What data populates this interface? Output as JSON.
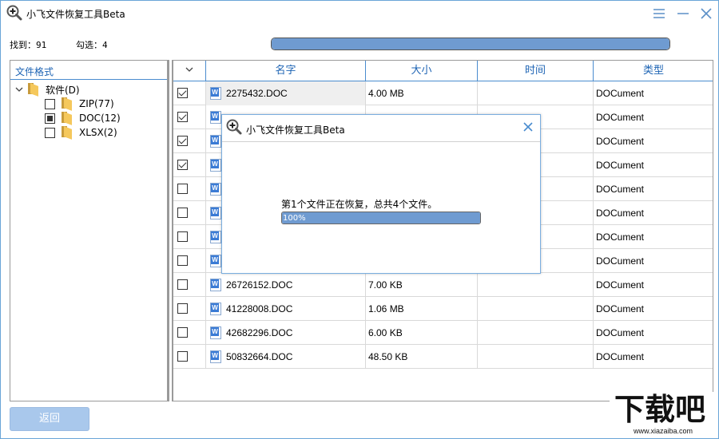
{
  "window": {
    "title": "小飞文件恢复工具Beta",
    "menu_icon": "hamburger-icon",
    "minimize_icon": "minimize-icon",
    "close_icon": "close-icon"
  },
  "stats": {
    "found_label": "找到：91",
    "checked_label": "勾选：4"
  },
  "scan_progress": {
    "fraction": 1.0
  },
  "tree": {
    "header": "文件格式",
    "root": {
      "label": "软件(D)",
      "expanded": true
    },
    "children": [
      {
        "label": "ZIP(77)",
        "state": "unchecked"
      },
      {
        "label": "DOC(12)",
        "state": "partial"
      },
      {
        "label": "XLSX(2)",
        "state": "unchecked"
      }
    ]
  },
  "table": {
    "columns": [
      "名字",
      "大小",
      "时间",
      "类型"
    ],
    "rows": [
      {
        "checked": true,
        "name": "2275432.DOC",
        "size": "4.00 MB",
        "time": "",
        "type": "DOCument"
      },
      {
        "checked": true,
        "name": "",
        "size": "",
        "time": "",
        "type": "DOCument"
      },
      {
        "checked": true,
        "name": "",
        "size": "",
        "time": "",
        "type": "DOCument"
      },
      {
        "checked": true,
        "name": "",
        "size": "",
        "time": "",
        "type": "DOCument"
      },
      {
        "checked": false,
        "name": "",
        "size": "",
        "time": "",
        "type": "DOCument"
      },
      {
        "checked": false,
        "name": "",
        "size": "",
        "time": "",
        "type": "DOCument"
      },
      {
        "checked": false,
        "name": "",
        "size": "",
        "time": "",
        "type": "DOCument"
      },
      {
        "checked": false,
        "name": "",
        "size": "",
        "time": "",
        "type": "DOCument"
      },
      {
        "checked": false,
        "name": "26726152.DOC",
        "size": "7.00 KB",
        "time": "",
        "type": "DOCument"
      },
      {
        "checked": false,
        "name": "41228008.DOC",
        "size": "1.06 MB",
        "time": "",
        "type": "DOCument"
      },
      {
        "checked": false,
        "name": "42682296.DOC",
        "size": "6.00 KB",
        "time": "",
        "type": "DOCument"
      },
      {
        "checked": false,
        "name": "50832664.DOC",
        "size": "48.50 KB",
        "time": "",
        "type": "DOCument"
      }
    ]
  },
  "back_button": {
    "label": "返回"
  },
  "dialog": {
    "title": "小飞文件恢复工具Beta",
    "status": "第1个文件正在恢复，总共4个文件。",
    "progress_label": "100%",
    "progress_fraction": 1.0
  },
  "watermark": {
    "logo_text": "下载吧",
    "url": "www.xiazaiba.com"
  },
  "colors": {
    "accent": "#1e64b4",
    "border": "#4a8ccf",
    "progress": "#6f9bd1",
    "button": "#a9c8ec"
  }
}
